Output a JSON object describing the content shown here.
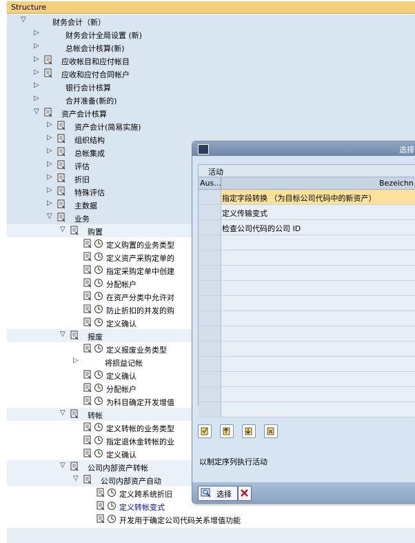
{
  "header": {
    "title": "Structure"
  },
  "tree": [
    {
      "label": "财务会计（新）",
      "level": 0,
      "toggle": "expanded",
      "icon": "none",
      "bg": "alt"
    },
    {
      "label": "财务会计全局设置 (新)",
      "level": 1,
      "toggle": "collapsed",
      "icon": "none",
      "bg": "alt"
    },
    {
      "label": "总帐会计核算(新)",
      "level": 1,
      "toggle": "collapsed",
      "icon": "none",
      "bg": "alt"
    },
    {
      "label": "应收帐目和应付帐目",
      "level": 1,
      "toggle": "collapsed",
      "icon": "doc",
      "bg": "alt"
    },
    {
      "label": "应收和应付合同帐户",
      "level": 1,
      "toggle": "collapsed",
      "icon": "doc",
      "bg": "alt"
    },
    {
      "label": "银行会计核算",
      "level": 1,
      "toggle": "collapsed",
      "icon": "none",
      "bg": "alt"
    },
    {
      "label": "合并准备(新的)",
      "level": 1,
      "toggle": "collapsed",
      "icon": "none",
      "bg": "alt"
    },
    {
      "label": "资产会计核算",
      "level": 1,
      "toggle": "expanded",
      "icon": "doc",
      "bg": "alt"
    },
    {
      "label": "资产会计(简易实施)",
      "level": 2,
      "toggle": "collapsed",
      "icon": "doc",
      "bg": "alt"
    },
    {
      "label": "组织结构",
      "level": 2,
      "toggle": "collapsed",
      "icon": "doc",
      "bg": "alt"
    },
    {
      "label": "总帐集成",
      "level": 2,
      "toggle": "collapsed",
      "icon": "doc",
      "bg": "alt"
    },
    {
      "label": "评估",
      "level": 2,
      "toggle": "collapsed",
      "icon": "doc",
      "bg": "alt"
    },
    {
      "label": "折旧",
      "level": 2,
      "toggle": "collapsed",
      "icon": "doc",
      "bg": "alt"
    },
    {
      "label": "特殊评估",
      "level": 2,
      "toggle": "collapsed",
      "icon": "doc",
      "bg": "alt"
    },
    {
      "label": "主数据",
      "level": 2,
      "toggle": "collapsed",
      "icon": "doc",
      "bg": "alt"
    },
    {
      "label": "业务",
      "level": 2,
      "toggle": "expanded",
      "icon": "doc",
      "bg": "alt"
    },
    {
      "label": "购置",
      "level": 3,
      "toggle": "expanded",
      "icon": "doc",
      "bg": "alt2"
    },
    {
      "label": "定义购置的业务类型",
      "level": 4,
      "toggle": "none",
      "icon": "docclock",
      "bg": "white"
    },
    {
      "label": "定义资产采购定单的",
      "level": 4,
      "toggle": "none",
      "icon": "docclock",
      "bg": "white"
    },
    {
      "label": "指定采购定单中创建",
      "level": 4,
      "toggle": "none",
      "icon": "docclock",
      "bg": "white"
    },
    {
      "label": "分配帐户",
      "level": 4,
      "toggle": "none",
      "icon": "docclock",
      "bg": "white"
    },
    {
      "label": "在资产分类中允许对",
      "level": 4,
      "toggle": "none",
      "icon": "docclock",
      "bg": "white"
    },
    {
      "label": "防止折扣的并发的购",
      "level": 4,
      "toggle": "none",
      "icon": "docclock",
      "bg": "white"
    },
    {
      "label": "定义确认",
      "level": 4,
      "toggle": "none",
      "icon": "docclock",
      "bg": "white"
    },
    {
      "label": "报废",
      "level": 3,
      "toggle": "expanded",
      "icon": "doc",
      "bg": "alt2"
    },
    {
      "label": "定义报废业务类型",
      "level": 4,
      "toggle": "none",
      "icon": "docclock",
      "bg": "white"
    },
    {
      "label": "将损益记帐",
      "level": 4,
      "toggle": "collapsed",
      "icon": "none",
      "bg": "white"
    },
    {
      "label": "定义确认",
      "level": 4,
      "toggle": "none",
      "icon": "docclock",
      "bg": "white"
    },
    {
      "label": "分配帐户",
      "level": 4,
      "toggle": "none",
      "icon": "docclock",
      "bg": "white"
    },
    {
      "label": "为科目确定开发增值",
      "level": 4,
      "toggle": "none",
      "icon": "docclock",
      "bg": "white"
    },
    {
      "label": "转帐",
      "level": 3,
      "toggle": "expanded",
      "icon": "doc",
      "bg": "alt2"
    },
    {
      "label": "定义转帐的业务类型",
      "level": 4,
      "toggle": "none",
      "icon": "docclock",
      "bg": "white"
    },
    {
      "label": "指定退休金转帐的业",
      "level": 4,
      "toggle": "none",
      "icon": "docclock",
      "bg": "white"
    },
    {
      "label": "定义确认",
      "level": 4,
      "toggle": "none",
      "icon": "docclock",
      "bg": "white"
    },
    {
      "label": "公司内部资产转帐",
      "level": 3,
      "toggle": "expanded",
      "icon": "doc",
      "bg": "alt2"
    },
    {
      "label": "公司内部资产自动",
      "level": 4,
      "toggle": "expanded",
      "icon": "doc",
      "bg": "alt2"
    },
    {
      "label": "定义跨系统折旧",
      "level": 5,
      "toggle": "none",
      "icon": "docclock",
      "bg": "white"
    },
    {
      "label": "定义转帐变式",
      "level": 5,
      "toggle": "none",
      "icon": "docclock",
      "bg": "white",
      "link": true
    },
    {
      "label": "开发用于确定公司代码关系增值功能",
      "level": 5,
      "toggle": "none",
      "icon": "docclock",
      "bg": "white"
    }
  ],
  "dialog": {
    "title": "选择",
    "grid_title": "活动",
    "col_sel": "Aus...",
    "col_desc": "Bezeichn",
    "rows": [
      {
        "text": "指定字段转换 （为目标公司代码中的新资产）",
        "highlight": true
      },
      {
        "text": "定义传输变式",
        "highlight": false
      },
      {
        "text": "检查公司代码的公司 ID",
        "highlight": false
      },
      {
        "text": "",
        "highlight": false
      },
      {
        "text": "",
        "highlight": false
      },
      {
        "text": "",
        "highlight": false
      },
      {
        "text": "",
        "highlight": false
      },
      {
        "text": "",
        "highlight": false
      },
      {
        "text": "",
        "highlight": false
      },
      {
        "text": "",
        "highlight": false
      },
      {
        "text": "",
        "highlight": false
      },
      {
        "text": "",
        "highlight": false
      },
      {
        "text": "",
        "highlight": false
      },
      {
        "text": "",
        "highlight": false
      },
      {
        "text": "",
        "highlight": false
      }
    ],
    "hint": "以制定序列执行活动",
    "select_label": "选择"
  }
}
